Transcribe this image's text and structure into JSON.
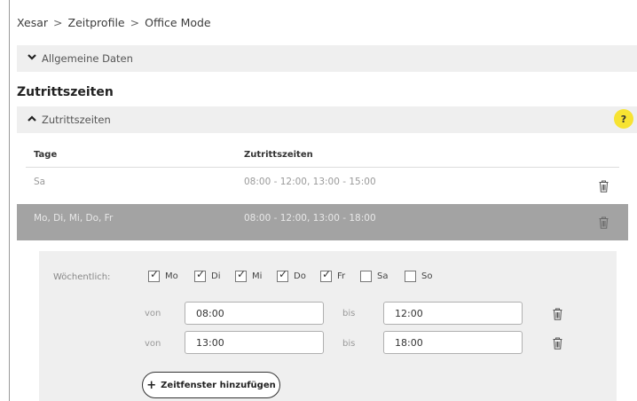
{
  "breadcrumb": {
    "items": [
      "Xesar",
      "Zeitprofile",
      "Office Mode"
    ],
    "separator": ">"
  },
  "panels": {
    "general": {
      "label": "Allgemeine Daten",
      "expanded": false
    },
    "access": {
      "label": "Zutrittszeiten",
      "expanded": true
    }
  },
  "section_title": "Zutrittszeiten",
  "help": {
    "label": "?",
    "color": "#f7e332"
  },
  "table": {
    "headers": {
      "days": "Tage",
      "times": "Zutrittszeiten"
    },
    "rows": [
      {
        "days": "Sa",
        "times": "08:00 - 12:00, 13:00 - 15:00",
        "selected": false
      },
      {
        "days": "Mo, Di, Mi, Do, Fr",
        "times": "08:00 - 12:00, 13:00 - 18:00",
        "selected": true
      }
    ]
  },
  "editor": {
    "weekly_label": "Wöchentlich:",
    "days": [
      {
        "label": "Mo",
        "checked": true
      },
      {
        "label": "Di",
        "checked": true
      },
      {
        "label": "Mi",
        "checked": true
      },
      {
        "label": "Do",
        "checked": true
      },
      {
        "label": "Fr",
        "checked": true
      },
      {
        "label": "Sa",
        "checked": false
      },
      {
        "label": "So",
        "checked": false
      }
    ],
    "from_label": "von",
    "to_label": "bis",
    "windows": [
      {
        "from": "08:00",
        "to": "12:00"
      },
      {
        "from": "13:00",
        "to": "18:00"
      }
    ],
    "add_button": "Zeitfenster hinzufügen"
  },
  "icons": {
    "trash": "trash-icon",
    "chevron_down": "chevron-down-icon",
    "chevron_up": "chevron-up-icon",
    "plus": "plus-icon"
  }
}
